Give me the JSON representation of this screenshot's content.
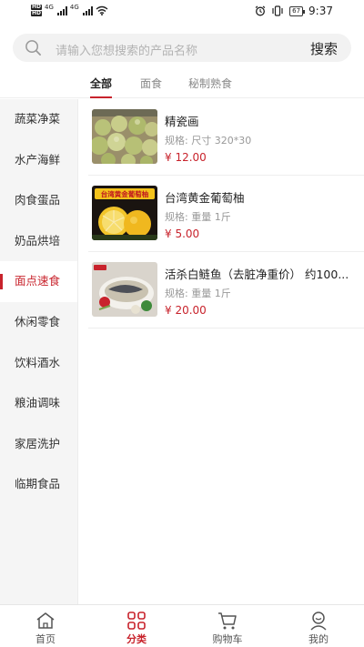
{
  "status_bar": {
    "sim_labels": [
      "HD",
      "HD"
    ],
    "network_labels": [
      "4G",
      "4G"
    ],
    "battery": "67",
    "time": "9:37"
  },
  "search": {
    "placeholder": "请输入您想搜索的产品名称",
    "button": "搜索"
  },
  "tabs": [
    {
      "label": "全部",
      "active": true
    },
    {
      "label": "面食",
      "active": false
    },
    {
      "label": "秘制熟食",
      "active": false
    }
  ],
  "sidebar": {
    "items": [
      {
        "label": "蔬菜净菜",
        "active": false
      },
      {
        "label": "水产海鲜",
        "active": false
      },
      {
        "label": "肉食蛋品",
        "active": false
      },
      {
        "label": "奶品烘培",
        "active": false
      },
      {
        "label": "面点速食",
        "active": true
      },
      {
        "label": "休闲零食",
        "active": false
      },
      {
        "label": "饮料酒水",
        "active": false
      },
      {
        "label": "粮油调味",
        "active": false
      },
      {
        "label": "家居洗护",
        "active": false
      },
      {
        "label": "临期食品",
        "active": false
      }
    ]
  },
  "products": [
    {
      "name": "精瓷画",
      "spec": "规格:  尺寸 320*30",
      "price": "¥ 12.00",
      "image": "green-oranges-photo"
    },
    {
      "name": "台湾黄金葡萄柚",
      "spec": "规格:  重量 1斤",
      "price": "¥ 5.00",
      "image": "grapefruit-photo",
      "image_banner": "台湾黄金葡萄柚"
    },
    {
      "name": "活杀白鲢鱼（去脏净重价） 约100...",
      "spec": "规格:  重量 1斤",
      "price": "¥ 20.00",
      "image": "fish-dish-photo"
    }
  ],
  "bottom_nav": [
    {
      "label": "首页",
      "icon": "home-icon",
      "active": false
    },
    {
      "label": "分类",
      "icon": "category-icon",
      "active": true
    },
    {
      "label": "购物车",
      "icon": "cart-icon",
      "active": false
    },
    {
      "label": "我的",
      "icon": "profile-icon",
      "active": false
    }
  ],
  "colors": {
    "accent": "#c8232c",
    "sidebar_bg": "#f5f5f5",
    "search_bg": "#f2f2f2"
  }
}
